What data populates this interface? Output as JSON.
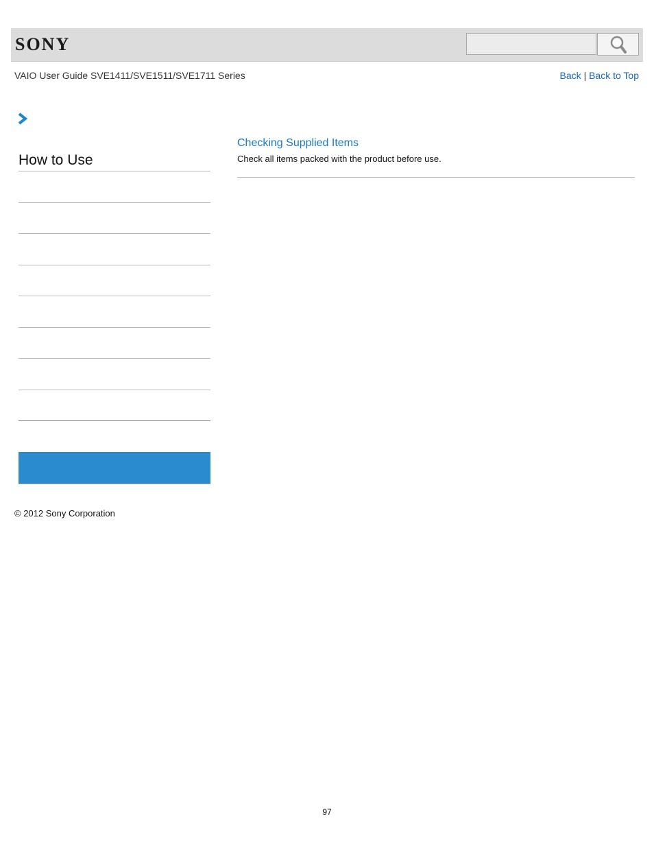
{
  "header": {
    "brand": "SONY",
    "search": {
      "value": "",
      "placeholder": ""
    }
  },
  "nav": {
    "guide_title": "VAIO User Guide SVE1411/SVE1511/SVE1711 Series",
    "back_label": "Back",
    "separator": "|",
    "back_to_top_label": "Back to Top"
  },
  "sidebar": {
    "title": "How to Use",
    "items": [
      "",
      "",
      "",
      "",
      "",
      "",
      "",
      "",
      ""
    ],
    "active_color": "#2a8ccf"
  },
  "content": {
    "topic_link": "Checking Supplied Items",
    "topic_description": "Check all items packed with the product before use."
  },
  "footer": {
    "copyright": "© 2012 Sony Corporation",
    "page_number": "97"
  },
  "colors": {
    "link": "#1a7bc4",
    "header_bg": "#dcdcdc",
    "chevron": "#1f86d1"
  },
  "icons": {
    "search": "search-icon",
    "chevron": "chevron-right-icon"
  }
}
